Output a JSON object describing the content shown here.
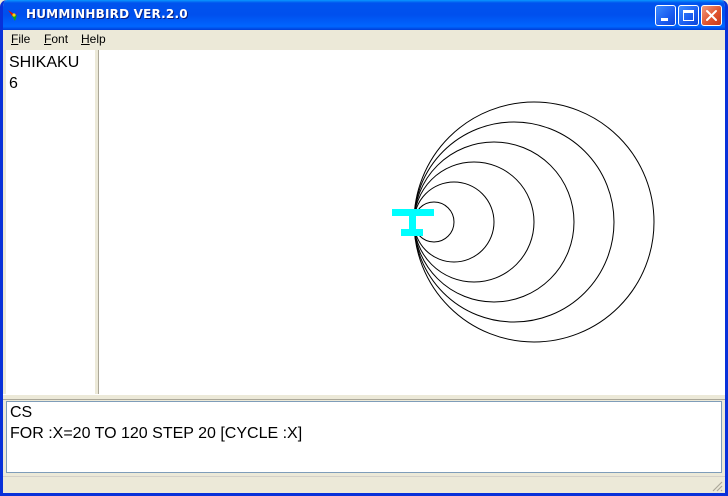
{
  "window": {
    "title": "HUMMINHBIRD VER.2.0",
    "title_bar_color": "#0054e3"
  },
  "titlebar_buttons": [
    {
      "name": "minimize",
      "icon": "minimize-icon"
    },
    {
      "name": "maximize",
      "icon": "maximize-icon"
    },
    {
      "name": "close",
      "icon": "close-icon"
    }
  ],
  "menu": {
    "file": {
      "mnemonic": "F",
      "rest": "ile"
    },
    "font": {
      "mnemonic": "F",
      "rest": "ont"
    },
    "help": {
      "mnemonic": "H",
      "rest": "elp"
    }
  },
  "procedures": {
    "name": "SHIKAKU",
    "value": "6"
  },
  "command": {
    "lines": [
      "CS",
      "FOR :X=20 TO 120 STEP 20 [CYCLE :X]"
    ]
  },
  "drawing": {
    "circle_radii": [
      20,
      40,
      60,
      80,
      100,
      120
    ],
    "stroke_color": "#000000",
    "turtle_color": "#00ffff"
  }
}
